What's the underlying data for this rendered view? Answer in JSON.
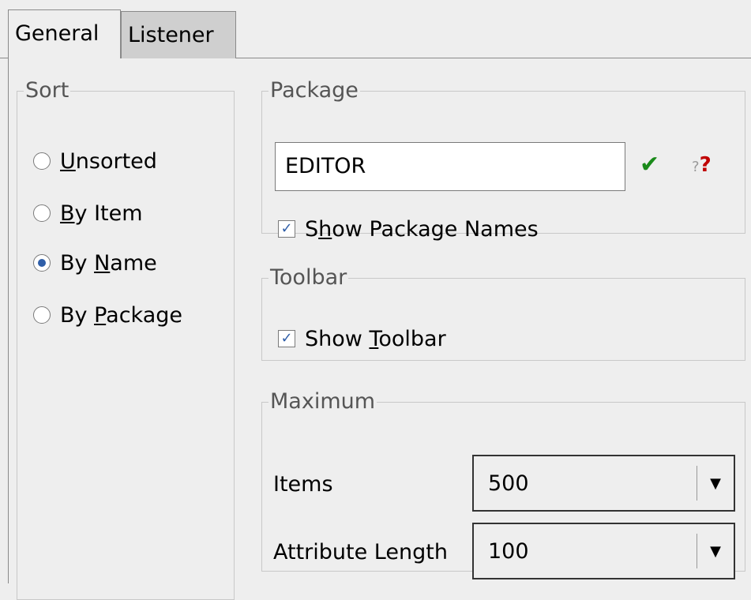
{
  "tabs": [
    {
      "label": "General",
      "selected": true
    },
    {
      "label": "Listener",
      "selected": false
    }
  ],
  "sort": {
    "legend": "Sort",
    "options": [
      {
        "pre": "",
        "mnemonic": "U",
        "post": "nsorted",
        "checked": false
      },
      {
        "pre": "",
        "mnemonic": "B",
        "post": "y Item",
        "checked": false
      },
      {
        "pre": "By ",
        "mnemonic": "N",
        "post": "ame",
        "checked": true
      },
      {
        "pre": "By ",
        "mnemonic": "P",
        "post": "ackage",
        "checked": false
      }
    ]
  },
  "package": {
    "legend": "Package",
    "input_value": "EDITOR",
    "ok_icon": "checkmark-icon",
    "help_icon": "help-question-icon",
    "show_names": {
      "pre": "S",
      "mnemonic": "h",
      "post": "ow Package Names",
      "checked": true
    }
  },
  "toolbar": {
    "legend": "Toolbar",
    "show_toolbar": {
      "pre": "Show ",
      "mnemonic": "T",
      "post": "oolbar",
      "checked": true
    }
  },
  "maximum": {
    "legend": "Maximum",
    "items_label": "Items",
    "items_value": "500",
    "attr_label": "Attribute Length",
    "attr_value": "100"
  }
}
